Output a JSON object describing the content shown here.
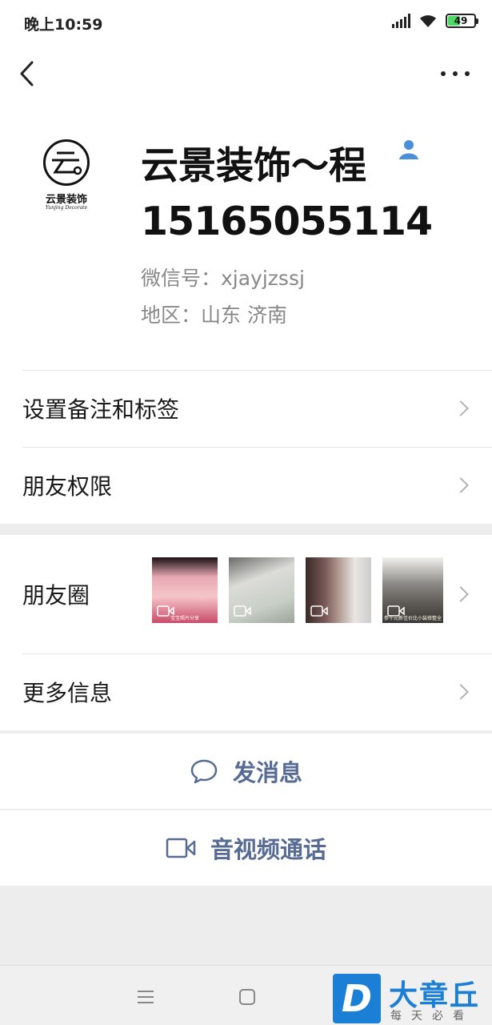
{
  "status_bar": {
    "time": "晚上10:59",
    "battery": 49
  },
  "profile": {
    "avatar_logo_title": "云景装饰",
    "avatar_logo_subtitle": "Yunjing Decorate",
    "nickname": "云景装饰～程",
    "phone": "15165055114",
    "wechat_id": "微信号：xjayjzssj",
    "region": "地区：山东  济南"
  },
  "menu": {
    "remark_tags": "设置备注和标签",
    "friend_permissions": "朋友权限",
    "moments": "朋友圈",
    "more_info": "更多信息"
  },
  "moments_thumbs": [
    {
      "caption": "宝宝照片分享",
      "has_video": true
    },
    {
      "caption": "",
      "has_video": true
    },
    {
      "caption": "",
      "has_video": true
    },
    {
      "caption": "参千元新佳价比小装修整全",
      "has_video": true
    }
  ],
  "actions": {
    "message": "发消息",
    "call": "音视频通话"
  },
  "watermark": {
    "letter": "D",
    "title": "大章丘",
    "subtitle": "每天必看"
  },
  "colors": {
    "link_blue": "#576b95",
    "page_gray": "#ededed",
    "watermark_blue": "#1b7fd6"
  }
}
